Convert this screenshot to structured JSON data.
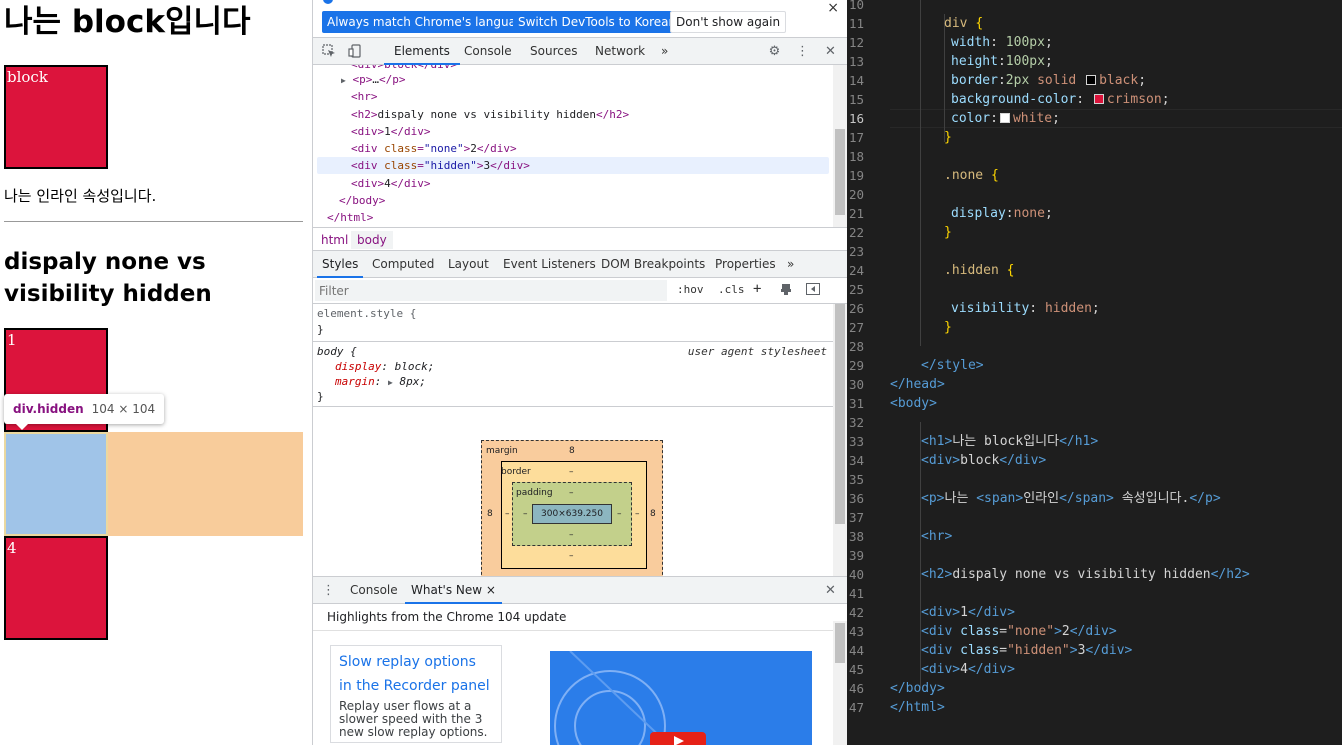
{
  "page": {
    "h1": "나는 block입니다",
    "block_box": "block",
    "paragraph": "나는 인라인 속성입니다.",
    "h2": "dispaly none vs visibility hidden",
    "box1": "1",
    "box4": "4",
    "tooltip_tag": "div.hidden",
    "tooltip_size": "104 × 104"
  },
  "devtools": {
    "infobar": {
      "match_language": "Always match Chrome's language",
      "switch_korean": "Switch DevTools to Korean",
      "dont_show": "Don't show again",
      "close": "×"
    },
    "tabs": [
      "Elements",
      "Console",
      "Sources",
      "Network",
      "»"
    ],
    "dom": {
      "l0": "<div>block</div>",
      "l1_open": "<p>",
      "l1_dots": "…",
      "l1_close": "</p>",
      "l2": "<hr>",
      "l3_open": "<h2>",
      "l3_text": "dispaly none vs visibility hidden",
      "l3_close": "</h2>",
      "l4_open": "<div>",
      "l4_text": "1",
      "l4_close": "</div>",
      "l5_tag": "<div ",
      "l5_attr": "class",
      "l5_val": "\"none\"",
      "l5_text": "2",
      "l5_close": "</div>",
      "l6_tag": "<div ",
      "l6_attr": "class",
      "l6_val": "\"hidden\"",
      "l6_text": "3",
      "l6_close": "</div>",
      "l7_open": "<div>",
      "l7_text": "4",
      "l7_close": "</div>",
      "l8": "</body>",
      "l9": "</html>"
    },
    "breadcrumbs": [
      "html",
      "body"
    ],
    "subtabs": [
      "Styles",
      "Computed",
      "Layout",
      "Event Listeners",
      "DOM Breakpoints",
      "Properties",
      "»"
    ],
    "filter_placeholder": "Filter",
    "hov": ":hov",
    "cls": ".cls",
    "styles": {
      "element_style": "element.style {",
      "close_brace": "}",
      "body_selector": "body {",
      "source": "user agent stylesheet",
      "prop1": "display",
      "val1": "block;",
      "prop2": "margin",
      "val2": "8px;"
    },
    "box_model": {
      "margin_label": "margin",
      "border_label": "border",
      "padding_label": "padding",
      "content_size": "300×639.250",
      "margin_top": "8",
      "margin_left": "8",
      "margin_right": "8",
      "dash": "–"
    },
    "drawer": {
      "tabs": [
        "Console",
        "What's New"
      ],
      "close_tab": "×",
      "highlights": "Highlights from the Chrome 104 update",
      "card_link": "Slow replay options in the Recorder panel",
      "card_desc": "Replay user flows at a slower speed with the 3 new slow replay options."
    }
  },
  "editor": {
    "line_numbers": [
      "10",
      "11",
      "12",
      "13",
      "14",
      "15",
      "16",
      "17",
      "18",
      "19",
      "20",
      "21",
      "22",
      "23",
      "24",
      "25",
      "26",
      "27",
      "28",
      "29",
      "30",
      "31",
      "32",
      "33",
      "34",
      "35",
      "36",
      "37",
      "38",
      "39",
      "40",
      "41",
      "42",
      "43",
      "44",
      "45",
      "46",
      "47"
    ],
    "current_line": "16",
    "code": {
      "div_sel": "div",
      "open_brace": "{",
      "close_brace": "}",
      "width_prop": "width",
      "width_num": "100px",
      "height_prop": "height",
      "height_num": "100px",
      "border_prop": "border",
      "border_num": "2px",
      "border_style": "solid",
      "border_color": "black",
      "bg_prop": "background-color",
      "bg_val": "crimson",
      "color_prop": "color",
      "color_val": "white",
      "none_sel": ".none",
      "display_prop": "display",
      "display_val": "none",
      "hidden_sel": ".hidden",
      "vis_prop": "visibility",
      "vis_val": "hidden",
      "style_close": "</style>",
      "head_close": "</head>",
      "body_open": "<body>",
      "h1_open": "<h1>",
      "h1_text": "나는 block입니다",
      "h1_close": "</h1>",
      "div_open": "<div>",
      "div_block_text": "block",
      "div_close": "</div>",
      "p_open": "<p>",
      "p_text1": "나는 ",
      "span_open": "<span>",
      "span_text": "인라인",
      "span_close": "</span>",
      "p_text2": " 속성입니다.",
      "p_close": "</p>",
      "hr": "<hr>",
      "h2_open": "<h2>",
      "h2_text": "dispaly none vs visibility hidden",
      "h2_close": "</h2>",
      "div1_text": "1",
      "div_class_open": "<div ",
      "class_attr": "class",
      "eq": "=",
      "none_str": "\"none\"",
      "gt": ">",
      "div2_text": "2",
      "hidden_str": "\"hidden\"",
      "div3_text": "3",
      "div4_text": "4",
      "body_close": "</body>",
      "html_close": "</html>"
    }
  },
  "colors": {
    "crimson": "#dc143c",
    "accent": "#1a73e8",
    "editor_bg": "#1e1e1e"
  }
}
